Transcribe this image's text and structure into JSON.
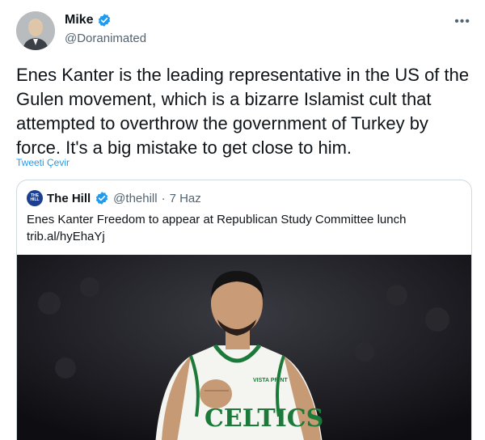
{
  "tweet": {
    "display_name": "Mike",
    "handle": "@Doranimated",
    "more_label": "•••",
    "text": "Enes Kanter is the leading representative in the US of the Gulen movement, which is a bizarre Islamist cult that attempted to overthrow the government of Turkey by force. It's a big mistake to get close to him.",
    "translate_label": "Tweeti Çevir"
  },
  "quoted": {
    "avatar_text": "THE HILL",
    "display_name": "The Hill",
    "handle": "@thehill",
    "separator": "·",
    "date": "7 Haz",
    "text_line1": "Enes Kanter Freedom to appear at Republican Study Committee lunch",
    "link": "trib.al/hyEhaYj",
    "jersey_brand": "VISTA PRINT",
    "jersey_text": "CELTICS"
  },
  "colors": {
    "accent": "#1d9bf0",
    "secondary_text": "#536471",
    "border": "#cfd9de",
    "celtics_green": "#1b7a3a"
  }
}
